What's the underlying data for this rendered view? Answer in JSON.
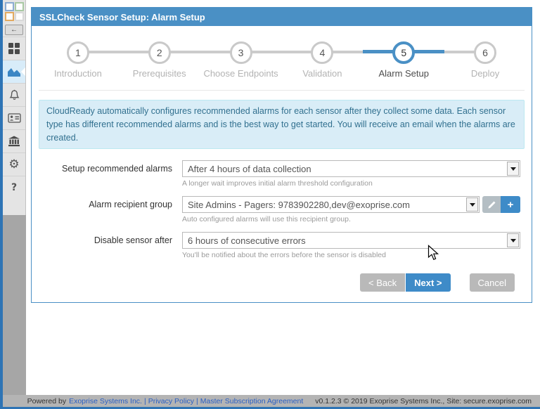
{
  "header": {
    "title": "SSLCheck Sensor Setup: Alarm Setup"
  },
  "sidebar": {
    "back_arrow": "←",
    "gear_glyph": "⚙",
    "help_glyph": "?"
  },
  "wizard": {
    "steps": [
      {
        "num": "1",
        "label": "Introduction"
      },
      {
        "num": "2",
        "label": "Prerequisites"
      },
      {
        "num": "3",
        "label": "Choose Endpoints"
      },
      {
        "num": "4",
        "label": "Validation"
      },
      {
        "num": "5",
        "label": "Alarm Setup"
      },
      {
        "num": "6",
        "label": "Deploy"
      }
    ],
    "active_step": "5"
  },
  "info_banner": {
    "text": "CloudReady automatically configures recommended alarms for each sensor after they collect some data. Each sensor type has different recommended alarms and is the best way to get started. You will receive an email when the alarms are created."
  },
  "form": {
    "rows": [
      {
        "label": "Setup recommended alarms",
        "value": "After 4 hours of data collection",
        "help": "A longer wait improves initial alarm threshold configuration"
      },
      {
        "label": "Alarm recipient group",
        "value": "Site Admins - Pagers: 9783902280,dev@exoprise.com",
        "help": "Auto configured alarms will use this recipient group."
      },
      {
        "label": "Disable sensor after",
        "value": "6 hours of consecutive errors",
        "help": "You'll be notified about the errors before the sensor is disabled"
      }
    ],
    "add_label": "+"
  },
  "actions": {
    "back": "< Back",
    "next": "Next >",
    "cancel": "Cancel"
  },
  "footer": {
    "powered_by": "Powered by",
    "link_company": "Exoprise Systems Inc.",
    "divider": "|",
    "link_privacy": "Privacy Policy",
    "link_msa": "Master Subscription Agreement",
    "version_text": "v0.1.2.3 © 2019 Exoprise Systems Inc., Site: secure.exoprise.com"
  },
  "colors": {
    "accent_blue": "#4a90c5",
    "strip_blue": "#2e74b5",
    "info_bg": "#d9edf7",
    "info_text": "#31708f",
    "inactive_gray": "#cccccc"
  }
}
